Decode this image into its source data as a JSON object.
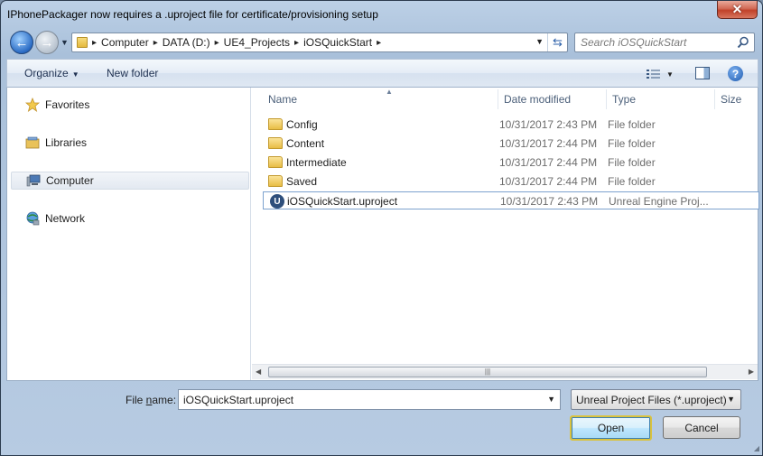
{
  "window": {
    "title": "IPhonePackager now requires a .uproject file for certificate/provisioning setup",
    "close_label": "✕"
  },
  "nav": {
    "back_icon": "back-arrow-icon",
    "forward_icon": "forward-arrow-icon",
    "breadcrumbs": [
      "Computer",
      "DATA (D:)",
      "UE4_Projects",
      "iOSQuickStart"
    ],
    "search_placeholder": "Search iOSQuickStart"
  },
  "toolbar": {
    "organize_label": "Organize",
    "new_folder_label": "New folder"
  },
  "sidebar": {
    "items": [
      {
        "label": "Favorites",
        "icon": "star-icon"
      },
      {
        "label": "Libraries",
        "icon": "libraries-icon"
      },
      {
        "label": "Computer",
        "icon": "computer-icon",
        "selected": true
      },
      {
        "label": "Network",
        "icon": "network-icon"
      }
    ]
  },
  "file_list": {
    "columns": [
      "Name",
      "Date modified",
      "Type",
      "Size"
    ],
    "rows": [
      {
        "name": "Config",
        "date": "10/31/2017 2:43 PM",
        "type": "File folder",
        "icon": "folder-icon"
      },
      {
        "name": "Content",
        "date": "10/31/2017 2:44 PM",
        "type": "File folder",
        "icon": "folder-icon"
      },
      {
        "name": "Intermediate",
        "date": "10/31/2017 2:44 PM",
        "type": "File folder",
        "icon": "folder-icon"
      },
      {
        "name": "Saved",
        "date": "10/31/2017 2:44 PM",
        "type": "File folder",
        "icon": "folder-icon"
      },
      {
        "name": "iOSQuickStart.uproject",
        "date": "10/31/2017 2:43 PM",
        "type": "Unreal Engine Proj...",
        "icon": "unreal-engine-icon",
        "selected": true
      }
    ]
  },
  "footer": {
    "file_name_label_pre": "File ",
    "file_name_label_key": "n",
    "file_name_label_post": "ame:",
    "file_name_value": "iOSQuickStart.uproject",
    "filter_value": "Unreal Project Files (*.uproject)",
    "open_label": "Open",
    "cancel_label": "Cancel"
  }
}
